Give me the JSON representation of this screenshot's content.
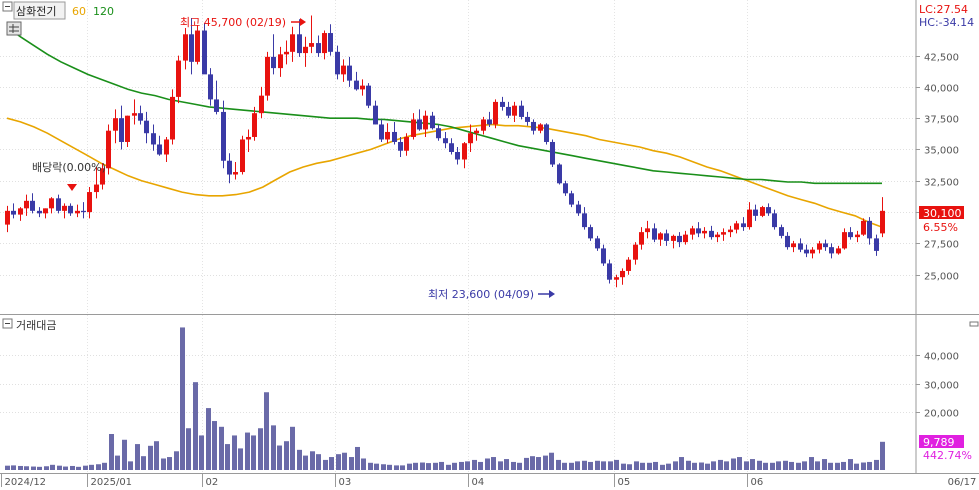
{
  "header": {
    "stock_name": "삼화전기",
    "ma_labels": [
      {
        "text": "60",
        "color": "#e8a500"
      },
      {
        "text": "120",
        "color": "#1a8f1a"
      }
    ]
  },
  "right_info": {
    "lc": "LC:27.54",
    "hc": "HC:-34.14",
    "last_price": "30,100",
    "last_change": "6.55%",
    "last_volume": "9,789",
    "volume_change": "442.74%"
  },
  "annotations": {
    "high": "최고 45,700 (02/19)",
    "low": "최저 23,600 (04/09)",
    "dividend": "배당락(0.00%)"
  },
  "volume_panel": {
    "title": "거래대금"
  },
  "colors": {
    "up": "#e8120f",
    "down": "#3a3aa6",
    "ma60": "#e8a500",
    "ma120": "#1a8f1a",
    "volume": "#6a6aa8",
    "price_badge": "#e8120f",
    "volume_badge": "#e020e0"
  },
  "chart_data": [
    {
      "type": "candlestick",
      "title": "",
      "x_labels": [
        "2024/12",
        "2025/01",
        "02",
        "03",
        "04",
        "05",
        "06",
        "06/17"
      ],
      "y_ticks": [
        "42,500",
        "40,000",
        "37,500",
        "35,000",
        "32,500",
        "30,000",
        "27,500",
        "25,000"
      ],
      "ylim": [
        22500,
        46300
      ],
      "grid": true,
      "last_close": 30100,
      "series": [
        {
          "name": "60",
          "values": [
            37500,
            37200,
            36800,
            36300,
            35700,
            35100,
            34500,
            33900,
            33400,
            32900,
            32500,
            32200,
            31900,
            31600,
            31400,
            31300,
            31300,
            31400,
            31600,
            32000,
            32600,
            33200,
            33600,
            33900,
            34100,
            34400,
            34700,
            35000,
            35400,
            35800,
            36100,
            36300,
            36500,
            36700,
            36800,
            36900,
            37000,
            36900,
            36900,
            36800,
            36700,
            36500,
            36300,
            36100,
            35800,
            35600,
            35400,
            35200,
            34900,
            34700,
            34400,
            34000,
            33600,
            33300,
            32900,
            32500,
            32100,
            31700,
            31300,
            31000,
            30700,
            30300,
            30000,
            29700,
            29200,
            28800
          ]
        },
        {
          "name": "120",
          "values": [
            44800,
            44000,
            43300,
            42600,
            42000,
            41500,
            41000,
            40600,
            40200,
            39800,
            39500,
            39300,
            39000,
            38800,
            38600,
            38400,
            38300,
            38200,
            38100,
            38000,
            37900,
            37800,
            37700,
            37600,
            37500,
            37500,
            37500,
            37400,
            37400,
            37300,
            37200,
            37100,
            37000,
            36800,
            36500,
            36200,
            35900,
            35600,
            35300,
            35100,
            34900,
            34700,
            34500,
            34300,
            34100,
            33900,
            33700,
            33500,
            33300,
            33200,
            33100,
            33000,
            32900,
            32800,
            32700,
            32600,
            32600,
            32500,
            32400,
            32400,
            32300,
            32300,
            32300,
            32300,
            32300,
            32300
          ]
        }
      ],
      "candles": [
        [
          29000,
          30500,
          28400,
          30100
        ],
        [
          30100,
          30700,
          29500,
          29800
        ],
        [
          29800,
          30400,
          29300,
          30300
        ],
        [
          30300,
          31400,
          29700,
          30900
        ],
        [
          30900,
          31500,
          29900,
          30100
        ],
        [
          30100,
          30400,
          29600,
          29900
        ],
        [
          29900,
          30300,
          29500,
          30300
        ],
        [
          30300,
          31200,
          29900,
          31100
        ],
        [
          31100,
          31400,
          29900,
          30100
        ],
        [
          30100,
          30700,
          29500,
          30500
        ],
        [
          30500,
          30700,
          29700,
          29900
        ],
        [
          29900,
          30600,
          29600,
          30100
        ],
        [
          30100,
          30800,
          29500,
          30000
        ],
        [
          30000,
          32000,
          29500,
          31600
        ],
        [
          31600,
          33600,
          31100,
          32200
        ],
        [
          32200,
          33900,
          31800,
          33500
        ],
        [
          33500,
          37000,
          33000,
          36500
        ],
        [
          36500,
          38200,
          35500,
          37500
        ],
        [
          37500,
          38500,
          35000,
          35600
        ],
        [
          35600,
          37700,
          35200,
          37700
        ],
        [
          37700,
          39000,
          37000,
          37900
        ],
        [
          37900,
          38500,
          37000,
          37300
        ],
        [
          37300,
          38000,
          35500,
          36300
        ],
        [
          36300,
          37000,
          34900,
          35400
        ],
        [
          35400,
          36100,
          34500,
          34600
        ],
        [
          34600,
          36000,
          34000,
          35800
        ],
        [
          35800,
          39800,
          35400,
          39200
        ],
        [
          39200,
          42500,
          38700,
          42100
        ],
        [
          42100,
          44700,
          41400,
          44200
        ],
        [
          44200,
          45500,
          41000,
          42000
        ],
        [
          42000,
          44900,
          41800,
          44500
        ],
        [
          44500,
          45100,
          41700,
          41000
        ],
        [
          41000,
          41500,
          38500,
          39000
        ],
        [
          39000,
          40500,
          37800,
          38000
        ],
        [
          38000,
          38900,
          33500,
          34100
        ],
        [
          34100,
          34700,
          32300,
          33000
        ],
        [
          33000,
          34000,
          32600,
          33200
        ],
        [
          33200,
          36100,
          33000,
          35800
        ],
        [
          35800,
          36600,
          34800,
          36000
        ],
        [
          36000,
          38400,
          35700,
          37900
        ],
        [
          37900,
          40000,
          37500,
          39300
        ],
        [
          39300,
          42800,
          38900,
          42400
        ],
        [
          42400,
          44200,
          41000,
          41500
        ],
        [
          41500,
          43200,
          40800,
          42600
        ],
        [
          42600,
          43700,
          41800,
          42800
        ],
        [
          42800,
          44800,
          42000,
          44200
        ],
        [
          44200,
          45400,
          42400,
          42700
        ],
        [
          42700,
          44000,
          41600,
          43200
        ],
        [
          43200,
          45700,
          42700,
          43500
        ],
        [
          43500,
          44100,
          42400,
          42700
        ],
        [
          42700,
          44500,
          42200,
          44300
        ],
        [
          44300,
          45000,
          42500,
          42800
        ],
        [
          42800,
          43300,
          40600,
          41000
        ],
        [
          41000,
          42200,
          40400,
          41700
        ],
        [
          41700,
          42400,
          40000,
          40500
        ],
        [
          40500,
          41200,
          39700,
          39800
        ],
        [
          39800,
          40600,
          39300,
          40100
        ],
        [
          40100,
          40300,
          38300,
          38500
        ],
        [
          38500,
          38900,
          37000,
          37000
        ],
        [
          37000,
          37400,
          35600,
          35800
        ],
        [
          35800,
          37100,
          35500,
          36400
        ],
        [
          36400,
          37200,
          35400,
          35600
        ],
        [
          35600,
          36000,
          34400,
          34900
        ],
        [
          34900,
          36300,
          34500,
          36000
        ],
        [
          36000,
          37900,
          35800,
          37400
        ],
        [
          37400,
          38200,
          36500,
          36600
        ],
        [
          36600,
          38100,
          36000,
          37700
        ],
        [
          37700,
          38000,
          36600,
          36700
        ],
        [
          36700,
          37000,
          35700,
          35900
        ],
        [
          35900,
          36400,
          35100,
          35500
        ],
        [
          35500,
          35900,
          34600,
          34800
        ],
        [
          34800,
          35200,
          33800,
          34200
        ],
        [
          34200,
          35600,
          33500,
          35500
        ],
        [
          35500,
          37000,
          34800,
          36300
        ],
        [
          36300,
          36700,
          35700,
          36500
        ],
        [
          36500,
          37600,
          36200,
          37400
        ],
        [
          37400,
          38000,
          36800,
          37000
        ],
        [
          37000,
          39000,
          36700,
          38800
        ],
        [
          38800,
          39200,
          38100,
          38400
        ],
        [
          38400,
          38800,
          37500,
          37700
        ],
        [
          37700,
          38800,
          37200,
          38500
        ],
        [
          38500,
          38900,
          37400,
          37600
        ],
        [
          37600,
          38000,
          36900,
          37200
        ],
        [
          37200,
          37400,
          36200,
          36500
        ],
        [
          36500,
          37100,
          36300,
          37000
        ],
        [
          37000,
          37100,
          35400,
          35600
        ],
        [
          35600,
          35800,
          33600,
          33800
        ],
        [
          33800,
          33900,
          32200,
          32300
        ],
        [
          32300,
          32500,
          31300,
          31500
        ],
        [
          31500,
          31700,
          30400,
          30600
        ],
        [
          30600,
          30900,
          29700,
          29900
        ],
        [
          29900,
          30400,
          28600,
          28800
        ],
        [
          28800,
          29000,
          27700,
          27900
        ],
        [
          27900,
          28100,
          26900,
          27100
        ],
        [
          27100,
          27400,
          25700,
          25900
        ],
        [
          25900,
          26200,
          24300,
          24600
        ],
        [
          24600,
          25000,
          24000,
          24800
        ],
        [
          24800,
          25500,
          24200,
          25300
        ],
        [
          25300,
          26400,
          25000,
          26200
        ],
        [
          26200,
          27600,
          25800,
          27400
        ],
        [
          27400,
          28800,
          27000,
          28400
        ],
        [
          28400,
          29300,
          27900,
          28700
        ],
        [
          28700,
          29100,
          27600,
          27800
        ],
        [
          27800,
          28400,
          27300,
          28300
        ],
        [
          28300,
          28600,
          27300,
          27700
        ],
        [
          27700,
          28200,
          27100,
          28100
        ],
        [
          28100,
          28400,
          27200,
          27600
        ],
        [
          27600,
          28500,
          27400,
          28200
        ],
        [
          28200,
          28900,
          27800,
          28700
        ],
        [
          28700,
          29200,
          28000,
          28300
        ],
        [
          28300,
          28800,
          27900,
          28500
        ],
        [
          28500,
          28900,
          27800,
          28000
        ],
        [
          28000,
          28400,
          27600,
          28200
        ],
        [
          28200,
          28700,
          27700,
          28400
        ],
        [
          28400,
          28900,
          28000,
          28600
        ],
        [
          28600,
          29300,
          28300,
          29100
        ],
        [
          29100,
          29600,
          28500,
          28800
        ],
        [
          28800,
          30800,
          28600,
          30200
        ],
        [
          30200,
          30600,
          29300,
          29700
        ],
        [
          29700,
          30500,
          29600,
          30400
        ],
        [
          30400,
          30700,
          29700,
          29900
        ],
        [
          29900,
          30200,
          28600,
          28800
        ],
        [
          28800,
          29000,
          27900,
          28100
        ],
        [
          28100,
          28400,
          27000,
          27200
        ],
        [
          27200,
          27700,
          26800,
          27500
        ],
        [
          27500,
          27900,
          26800,
          27000
        ],
        [
          27000,
          27400,
          26400,
          26700
        ],
        [
          26700,
          27200,
          26300,
          27000
        ],
        [
          27000,
          27700,
          26700,
          27500
        ],
        [
          27500,
          27800,
          26900,
          27200
        ],
        [
          27200,
          27500,
          26300,
          26700
        ],
        [
          26700,
          27300,
          26600,
          27100
        ],
        [
          27100,
          28700,
          27000,
          28400
        ],
        [
          28400,
          28800,
          27800,
          28000
        ],
        [
          28000,
          28500,
          27600,
          28200
        ],
        [
          28200,
          29500,
          28100,
          29300
        ],
        [
          29300,
          29600,
          27400,
          27900
        ],
        [
          27900,
          28200,
          26500,
          26900
        ],
        [
          28300,
          31200,
          28000,
          30100
        ]
      ]
    },
    {
      "type": "bar",
      "title": "거래대금",
      "y_ticks": [
        "40,000",
        "30,000",
        "20,000"
      ],
      "ylim": [
        0,
        50000
      ],
      "values": [
        1500,
        1600,
        1400,
        1300,
        1200,
        1100,
        1300,
        1800,
        1500,
        1200,
        1400,
        1100,
        1500,
        1800,
        2000,
        2500,
        12500,
        5000,
        10500,
        3000,
        9000,
        4800,
        8400,
        10000,
        4000,
        4500,
        6500,
        49500,
        14500,
        30500,
        12000,
        21500,
        17000,
        15000,
        9000,
        12000,
        7500,
        13000,
        12000,
        14500,
        27000,
        15500,
        8500,
        10000,
        15000,
        7000,
        5000,
        6500,
        5500,
        3500,
        4500,
        5500,
        6000,
        4500,
        8000,
        4000,
        2500,
        2200,
        2000,
        1800,
        1600,
        1600,
        2200,
        2500,
        2600,
        2400,
        2500,
        2800,
        1800,
        2500,
        2800,
        3000,
        3500,
        2800,
        4000,
        4500,
        3000,
        3800,
        2800,
        2500,
        4200,
        4800,
        4500,
        5000,
        6000,
        3500,
        2500,
        2500,
        3000,
        3200,
        2800,
        3200,
        3000,
        3000,
        3500,
        2200,
        2000,
        3000,
        2500,
        2500,
        2800,
        1800,
        2200,
        3000,
        4500,
        3200,
        2500,
        2600,
        2200,
        3000,
        3500,
        3000,
        4000,
        4500,
        3000,
        3800,
        3200,
        2500,
        2500,
        3000,
        3200,
        2800,
        2500,
        3000,
        4500,
        3000,
        3800,
        2500,
        2500,
        2800,
        3800,
        2200,
        2600,
        2800,
        3500,
        9789
      ]
    }
  ]
}
